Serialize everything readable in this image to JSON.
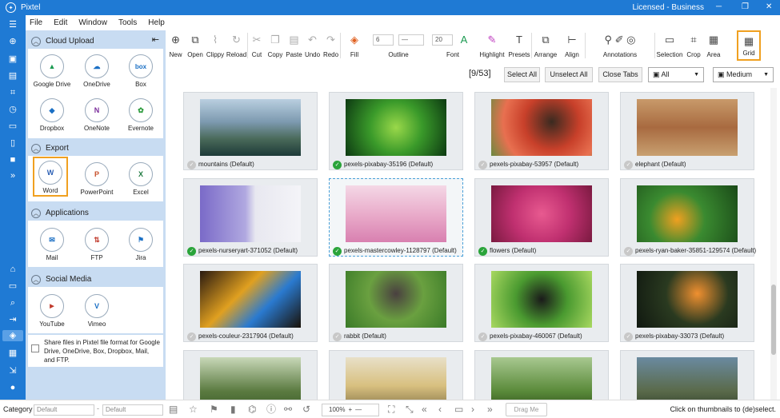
{
  "app": {
    "title": "Pixtel",
    "license": "Licensed - Business"
  },
  "menu": [
    "File",
    "Edit",
    "Window",
    "Tools",
    "Help"
  ],
  "panel": {
    "sections": [
      {
        "title": "Cloud Upload",
        "items": [
          {
            "label": "Google Drive"
          },
          {
            "label": "OneDrive"
          },
          {
            "label": "Box"
          },
          {
            "label": "Dropbox"
          },
          {
            "label": "OneNote"
          },
          {
            "label": "Evernote"
          }
        ]
      },
      {
        "title": "Export",
        "items": [
          {
            "label": "Word"
          },
          {
            "label": "PowerPoint"
          },
          {
            "label": "Excel"
          }
        ]
      },
      {
        "title": "Applications",
        "items": [
          {
            "label": "Mail"
          },
          {
            "label": "FTP"
          },
          {
            "label": "Jira"
          }
        ]
      },
      {
        "title": "Social Media",
        "items": [
          {
            "label": "YouTube"
          },
          {
            "label": "Vimeo"
          }
        ]
      }
    ],
    "share_text": "Share files in Pixtel file format for Google Drive, OneDrive, Box, Dropbox, Mail, and FTP."
  },
  "toolbar": {
    "new": "New",
    "open": "Open",
    "clippy": "Clippy",
    "reload": "Reload",
    "cut": "Cut",
    "copy": "Copy",
    "paste": "Paste",
    "undo": "Undo",
    "redo": "Redo",
    "fill": "Fill",
    "outline": "Outline",
    "outline_width": "6",
    "font": "Font",
    "font_size": "20",
    "highlight": "Highlight",
    "presets": "Presets",
    "arrange": "Arrange",
    "align": "Align",
    "annotations": "Annotations",
    "selection": "Selection",
    "crop": "Crop",
    "area": "Area",
    "grid": "Grid"
  },
  "actions": {
    "counter": "[9/53]",
    "select_all": "Select All",
    "unselect_all": "Unselect All",
    "close_tabs": "Close Tabs",
    "filter_value": "All",
    "size_value": "Medium"
  },
  "thumbnails": [
    {
      "label": "mountains (Default)",
      "checked": false
    },
    {
      "label": "pexels-pixabay-35196 (Default)",
      "checked": true
    },
    {
      "label": "pexels-pixabay-53957 (Default)",
      "checked": false
    },
    {
      "label": "elephant  (Default)",
      "checked": false
    },
    {
      "label": "pexels-nurseryart-371052 (Default)",
      "checked": true
    },
    {
      "label": "pexels-mastercowley-1128797 (Default)",
      "checked": true
    },
    {
      "label": "flowers (Default)",
      "checked": true
    },
    {
      "label": "pexels-ryan-baker-35851-129574 (Default)",
      "checked": false
    },
    {
      "label": "pexels-couleur-2317904 (Default)",
      "checked": false
    },
    {
      "label": "rabbit (Default)",
      "checked": false
    },
    {
      "label": "pexels-pixabay-460067 (Default)",
      "checked": false
    },
    {
      "label": "pexels-pixabay-33073 (Default)",
      "checked": false
    },
    {
      "label": "",
      "checked": false
    },
    {
      "label": "",
      "checked": false
    },
    {
      "label": "",
      "checked": false
    },
    {
      "label": "",
      "checked": false
    }
  ],
  "status": {
    "category_label": "Category",
    "category_value": "Default",
    "category_value2": "Default",
    "zoom": "100%",
    "drag": "Drag Me",
    "hint": "Click on thumbnails to (de)select."
  },
  "colors": {
    "accent": "#1f7ad4",
    "panel_bg": "#c8dcf2",
    "highlight": "#f0a020",
    "check_on": "#2aa43a"
  }
}
